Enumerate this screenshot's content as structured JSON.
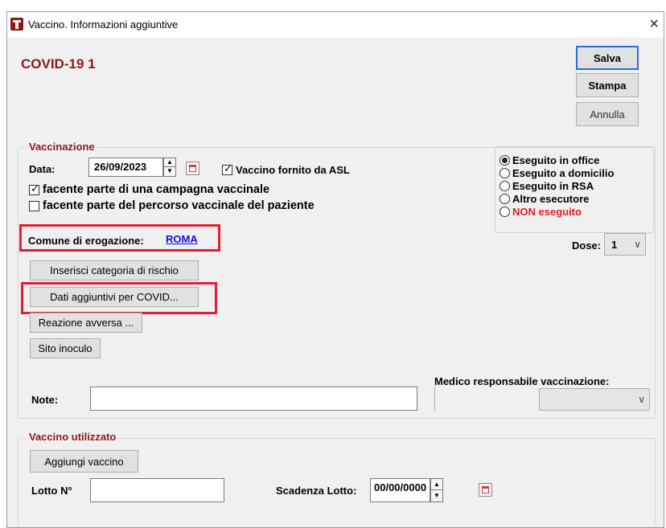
{
  "window": {
    "title": "Vaccino. Informazioni aggiuntive",
    "close_glyph": "×"
  },
  "header": {
    "vaccine_title": "COVID-19 1"
  },
  "buttons": {
    "save": "Salva",
    "print": "Stampa",
    "cancel": "Annulla",
    "risk_category": "Inserisci categoria di rischio",
    "covid_extra": "Dati aggiuntivi per COVID...",
    "adverse_reaction": "Reazione avversa ...",
    "injection_site": "Sito inoculo",
    "add_vaccine": "Aggiungi vaccino"
  },
  "vaccination": {
    "legend": "Vaccinazione",
    "date_label": "Data:",
    "date_value": "26/09/2023",
    "asl_label": "Vaccino fornito da ASL",
    "asl_checked": true,
    "campaign_label": "facente parte di una campagna vaccinale",
    "campaign_checked": true,
    "path_label": "facente parte del percorso vaccinale del paziente",
    "path_checked": false,
    "municipality_label": "Comune di erogazione:",
    "municipality_value": "ROMA",
    "dose_label": "Dose:",
    "dose_value": "1",
    "notes_label": "Note:",
    "notes_value": "",
    "doctor_label": "Medico responsabile vaccinazione:",
    "doctor_value": "",
    "execution_options": [
      {
        "label": "Eseguito in office",
        "selected": true,
        "color": "#000000"
      },
      {
        "label": "Eseguito a domicilio",
        "selected": false,
        "color": "#000000"
      },
      {
        "label": "Eseguito in RSA",
        "selected": false,
        "color": "#000000"
      },
      {
        "label": "Altro esecutore",
        "selected": false,
        "color": "#000000"
      },
      {
        "label": "NON eseguito",
        "selected": false,
        "color": "#e02020"
      }
    ]
  },
  "vaccine_used": {
    "legend": "Vaccino utilizzato",
    "lot_label": "Lotto N°",
    "lot_value": "",
    "expiry_label": "Scadenza Lotto:",
    "expiry_value": "00/00/0000"
  },
  "colors": {
    "accent": "#8b1a1a",
    "highlight": "#e02030",
    "link": "#1010e0"
  }
}
